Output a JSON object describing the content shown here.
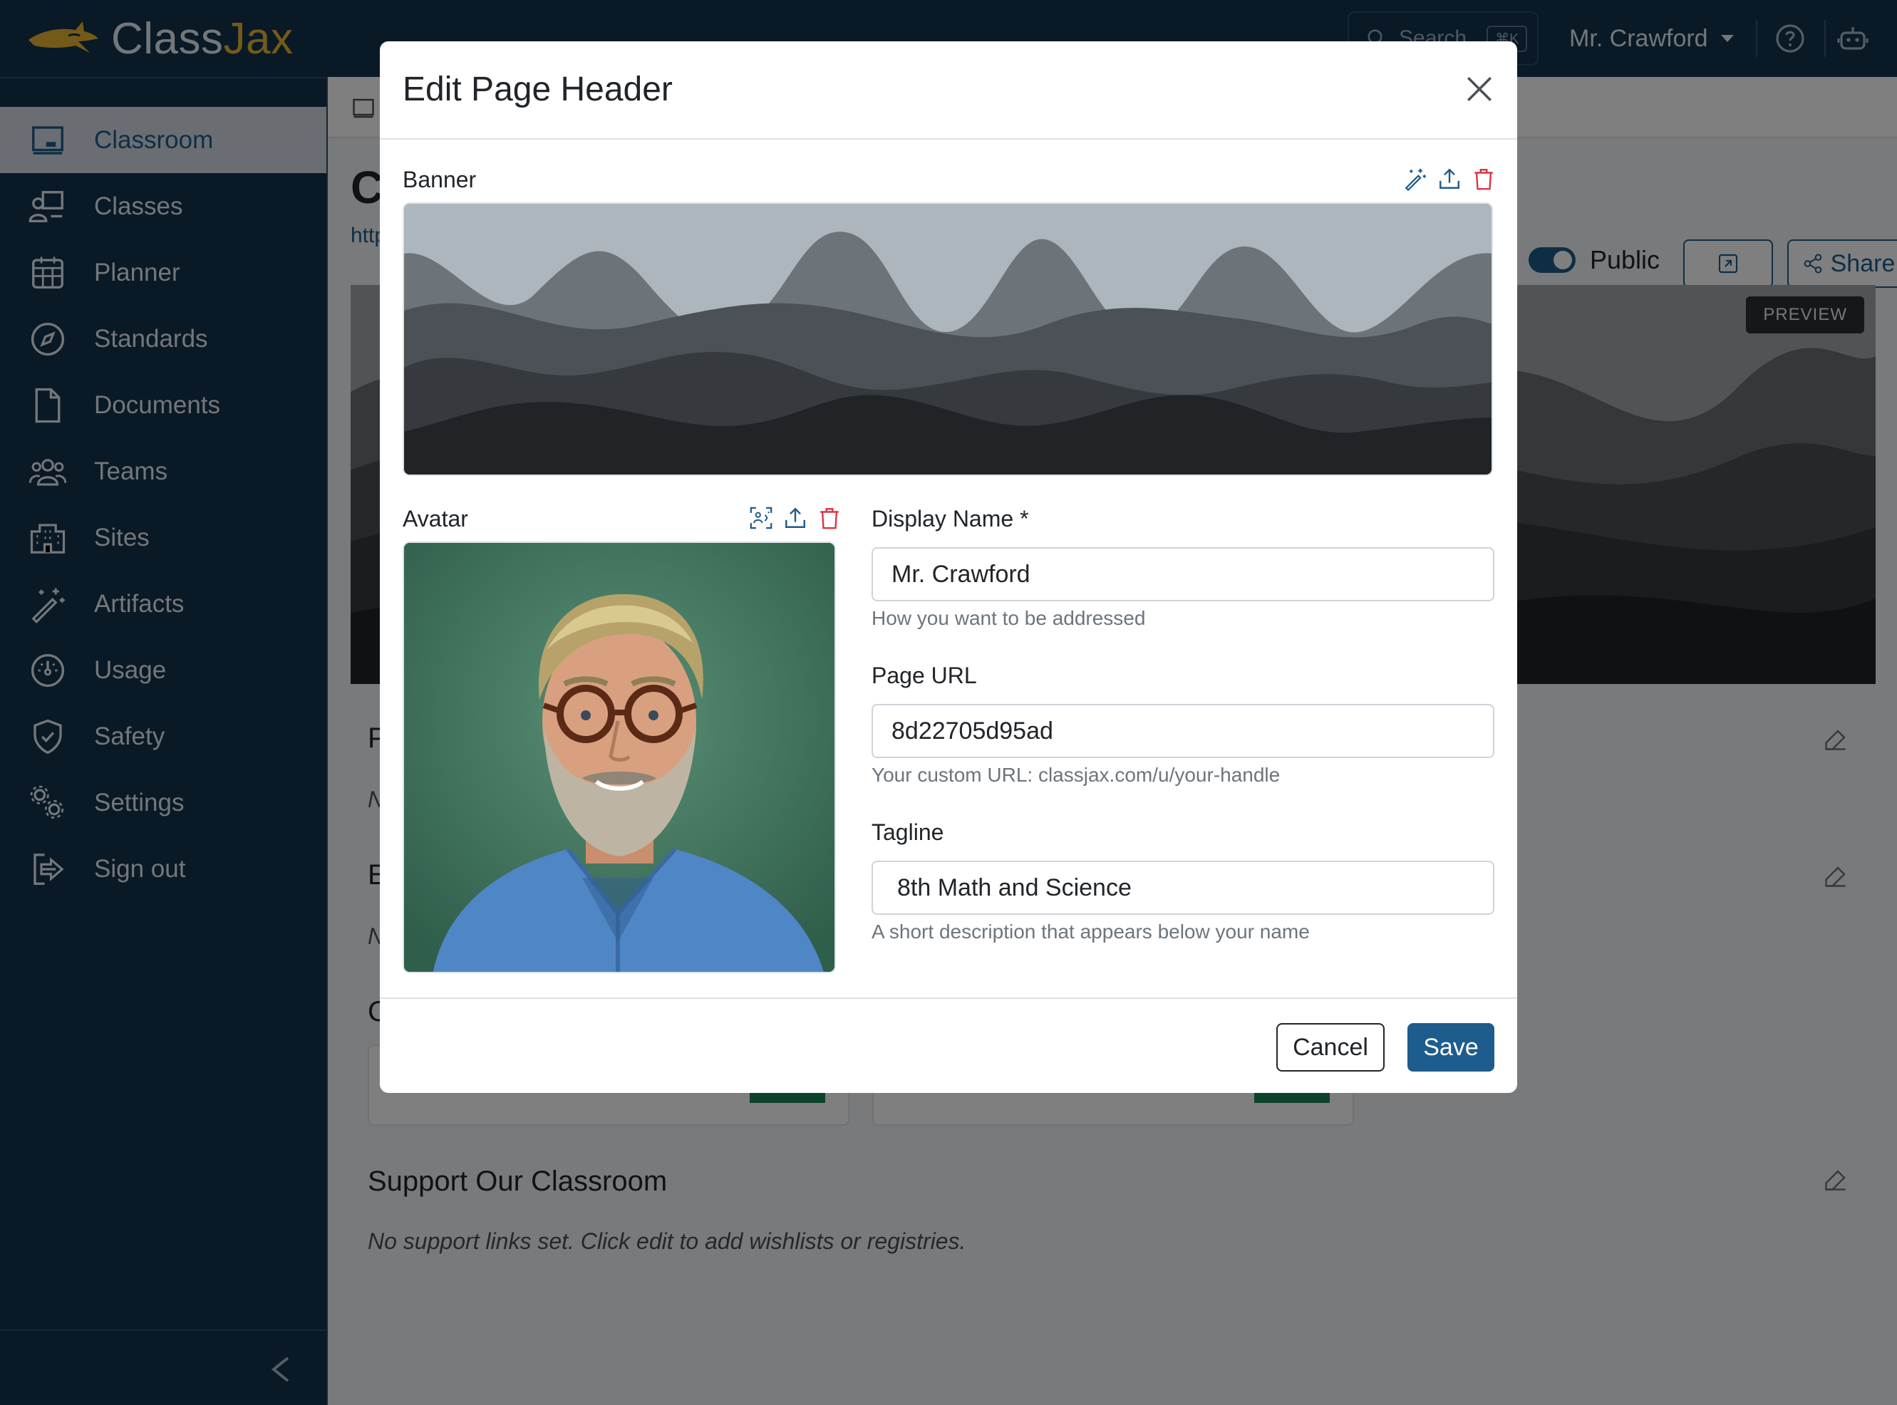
{
  "app": {
    "brand_first": "Class",
    "brand_second": "Jax",
    "search_placeholder": "Search",
    "search_shortcut": "⌘K",
    "user_name": "Mr. Crawford"
  },
  "sidebar": {
    "items": [
      {
        "label": "Classroom",
        "icon": "classroom-icon",
        "active": true
      },
      {
        "label": "Classes",
        "icon": "classes-icon"
      },
      {
        "label": "Planner",
        "icon": "calendar-icon"
      },
      {
        "label": "Standards",
        "icon": "compass-icon"
      },
      {
        "label": "Documents",
        "icon": "document-icon"
      },
      {
        "label": "Teams",
        "icon": "people-icon"
      },
      {
        "label": "Sites",
        "icon": "building-icon"
      },
      {
        "label": "Artifacts",
        "icon": "magic-wand-icon"
      },
      {
        "label": "Usage",
        "icon": "speedometer-icon"
      },
      {
        "label": "Safety",
        "icon": "shield-check-icon"
      },
      {
        "label": "Settings",
        "icon": "gears-icon"
      },
      {
        "label": "Sign out",
        "icon": "sign-out-icon"
      }
    ]
  },
  "page": {
    "title_fragment": "C",
    "link_fragment": "http",
    "public_label": "Public",
    "share_label": "Share",
    "preview_badge": "PREVIEW",
    "section_initials": [
      "P",
      "E",
      "C"
    ],
    "section_text_initials": [
      "N",
      "N"
    ],
    "support_title": "Support Our Classroom",
    "support_text": "No support links set. Click edit to add wishlists or registries."
  },
  "modal": {
    "title": "Edit Page Header",
    "banner_label": "Banner",
    "avatar_label": "Avatar",
    "display_name": {
      "label": "Display Name *",
      "value": "Mr. Crawford",
      "help": "How you want to be addressed"
    },
    "page_url": {
      "label": "Page URL",
      "value": "8d22705d95ad",
      "help": "Your custom URL: classjax.com/u/your-handle"
    },
    "tagline": {
      "label": "Tagline",
      "value": "8th Math and Science",
      "help": "A short description that appears below your name"
    },
    "cancel_label": "Cancel",
    "save_label": "Save"
  },
  "colors": {
    "nav_bg": "#14324d",
    "accent": "#1d5c8c",
    "brand_gold": "#e8b530",
    "danger": "#dc3545"
  }
}
